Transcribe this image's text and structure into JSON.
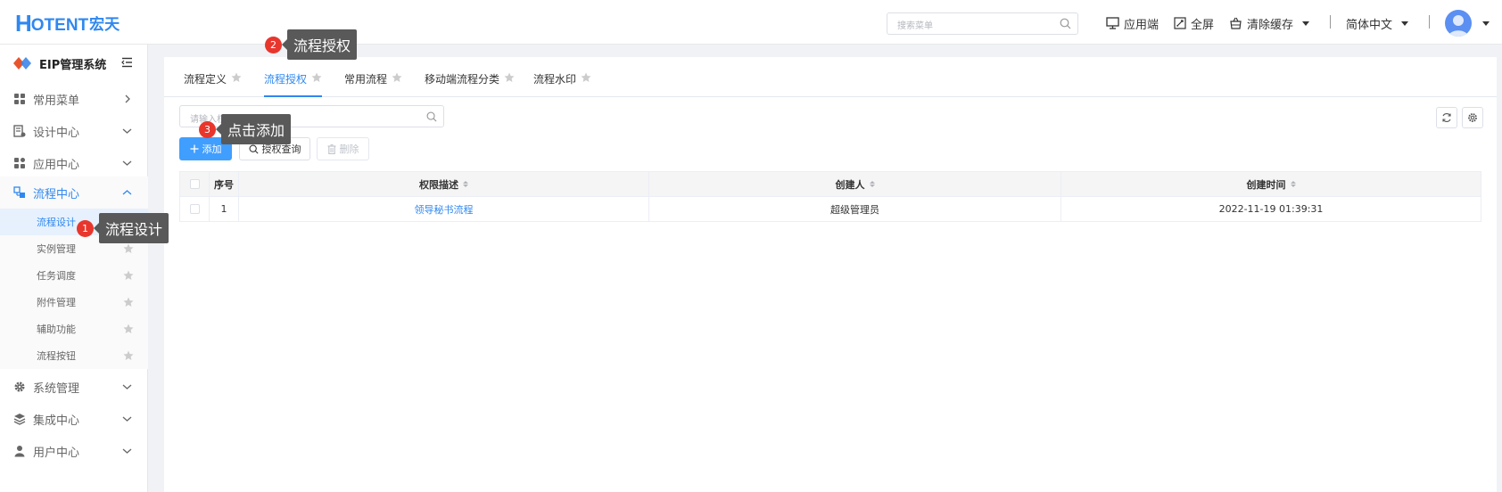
{
  "header": {
    "logo_h": "H",
    "logo_rest": "OTENT",
    "logo_cn": "宏天",
    "search_placeholder": "搜索菜单",
    "app_client": "应用端",
    "fullscreen": "全屏",
    "clear_cache": "清除缓存",
    "language": "简体中文"
  },
  "sidebar": {
    "system_name": "EIP管理系统",
    "items": [
      {
        "label": "常用菜单",
        "icon": "grid-icon"
      },
      {
        "label": "设计中心",
        "icon": "design-icon"
      },
      {
        "label": "应用中心",
        "icon": "apps-icon"
      },
      {
        "label": "流程中心",
        "icon": "flow-icon"
      },
      {
        "label": "系统管理",
        "icon": "gear-icon"
      },
      {
        "label": "集成中心",
        "icon": "layers-icon"
      },
      {
        "label": "用户中心",
        "icon": "user-icon"
      }
    ],
    "sub_items": [
      "流程设计",
      "实例管理",
      "任务调度",
      "附件管理",
      "辅助功能",
      "流程按钮"
    ]
  },
  "tabs": [
    "流程定义",
    "流程授权",
    "常用流程",
    "移动端流程分类",
    "流程水印"
  ],
  "toolbar": {
    "search_placeholder": "请输入权限描述查询",
    "add": "添加",
    "query": "授权查询",
    "delete": "删除"
  },
  "table": {
    "columns": [
      "序号",
      "权限描述",
      "创建人",
      "创建时间"
    ],
    "rows": [
      {
        "index": "1",
        "desc": "领导秘书流程",
        "creator": "超级管理员",
        "created": "2022-11-19 01:39:31"
      }
    ]
  },
  "callouts": [
    {
      "num": "1",
      "text": "流程设计"
    },
    {
      "num": "2",
      "text": "流程授权"
    },
    {
      "num": "3",
      "text": "点击添加"
    }
  ],
  "colors": {
    "accent": "#2f88f0",
    "badge": "#e8362d",
    "tooltip": "#595959"
  }
}
